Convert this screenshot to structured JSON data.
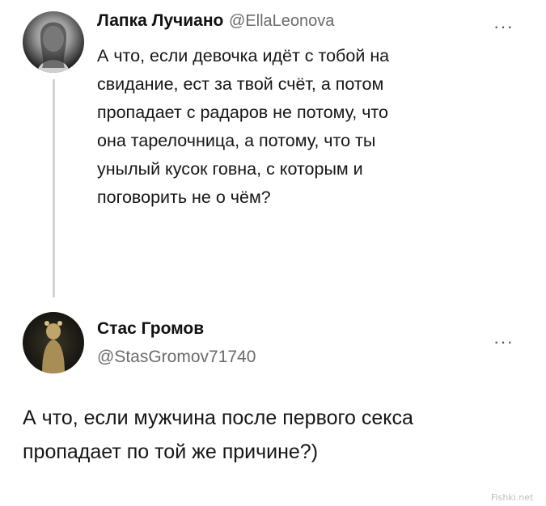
{
  "tweet1": {
    "author": "Лапка Лучиано",
    "handle": "@EllaLeonova",
    "more_label": "···",
    "lines": [
      "А что, если девочка идёт с тобой на",
      "свидание, ест за твой счёт, а потом",
      "пропадает с радаров не потому, что",
      "она тарелочница, а потому, что ты",
      "унылый кусок говна, с которым и",
      "поговорить не о чём?"
    ]
  },
  "tweet2": {
    "author": "Стас Громов",
    "handle": "@StasGromov71740",
    "more_label": "···",
    "lines": [
      "А что, если мужчина после первого секса",
      "пропадает по той же причине?)"
    ]
  },
  "watermark": "Fishki.net"
}
